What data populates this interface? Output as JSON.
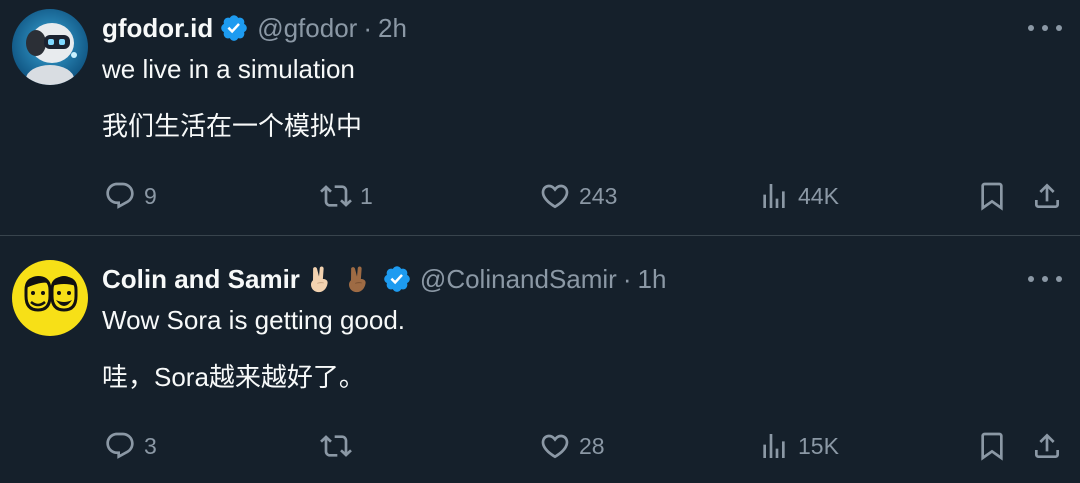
{
  "colors": {
    "background": "#15202b",
    "divider": "#38444d",
    "text_primary": "#f7f9f9",
    "text_secondary": "#8b98a5",
    "verified_badge": "#1d9bf0",
    "avatar2_bg": "#f7e017"
  },
  "tweets": [
    {
      "display_name": "gfodor.id",
      "verified": true,
      "handle": "@gfodor",
      "separator": "·",
      "time": "2h",
      "lines": [
        "we live in a simulation",
        "我们生活在一个模拟中"
      ],
      "avatar_icon": "robot-avatar",
      "stats": {
        "replies": "9",
        "retweets": "1",
        "likes": "243",
        "views": "44K"
      }
    },
    {
      "display_name": "Colin and Samir",
      "emojis": [
        "victory-hand-light-emoji",
        "victory-hand-medium-emoji"
      ],
      "verified": true,
      "handle": "@ColinandSamir",
      "separator": "·",
      "time": "1h",
      "lines": [
        "Wow Sora is getting good.",
        "哇，Sora越来越好了。"
      ],
      "avatar_icon": "two-faces-avatar",
      "stats": {
        "replies": "3",
        "retweets": "",
        "likes": "28",
        "views": "15K"
      }
    }
  ]
}
